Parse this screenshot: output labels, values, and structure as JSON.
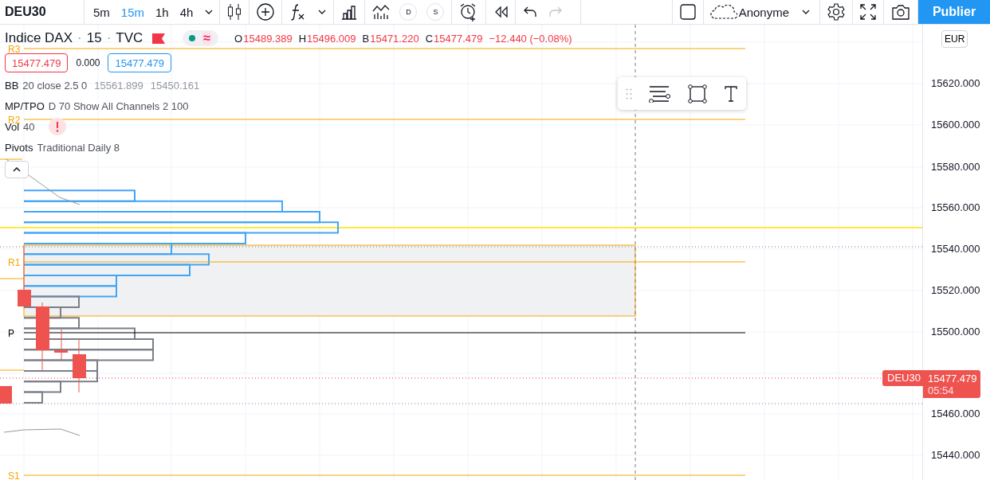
{
  "toolbar": {
    "symbol": "DEU30",
    "intervals": [
      {
        "label": "5m",
        "selected": false
      },
      {
        "label": "15m",
        "selected": true
      },
      {
        "label": "1h",
        "selected": false
      },
      {
        "label": "4h",
        "selected": false
      }
    ],
    "study_badges": [
      "D",
      "S"
    ],
    "history": [
      {
        "kind": "undo",
        "disabled": false
      },
      {
        "kind": "redo",
        "disabled": true
      }
    ],
    "account": "Anonyme",
    "publish": "Publier"
  },
  "legend": {
    "title": "Indice DAX",
    "separators": [
      "·",
      "·"
    ],
    "interval": "15",
    "source": "TVC",
    "status_glyph": "≈",
    "ohlc": [
      {
        "label": "O",
        "value": "15489.389"
      },
      {
        "label": "H",
        "value": "15496.009"
      },
      {
        "label": "B",
        "value": "15471.220"
      },
      {
        "label": "C",
        "value": "15477.479"
      }
    ],
    "change": "−12.440 (−0.08%)",
    "bid": "15477.479",
    "spread": "0.000",
    "ask": "15477.479"
  },
  "indicators": [
    {
      "name": "BB",
      "params": "20 close 2.5 0",
      "values": [
        "15561.899",
        "15450.161"
      ],
      "warning": false
    },
    {
      "name": "MP/TPO",
      "params": "D 70 Show All Channels 2 100",
      "warning": false
    },
    {
      "name": "Vol",
      "params": "40",
      "warning": true
    },
    {
      "name": "Pivots",
      "params": "Traditional Daily 8",
      "warning": false
    }
  ],
  "pivots": [
    "R3",
    "R2",
    "R1",
    "P",
    "S1"
  ],
  "price_axis": {
    "currency": "EUR",
    "labels": [
      "15620.000",
      "15600.000",
      "15580.000",
      "15560.000",
      "15540.000",
      "15520.000",
      "15500.000",
      "15460.000",
      "15440.000"
    ]
  },
  "price_tag": {
    "symbol": "DEU30",
    "price": "15477.479",
    "countdown": "05:54"
  }
}
